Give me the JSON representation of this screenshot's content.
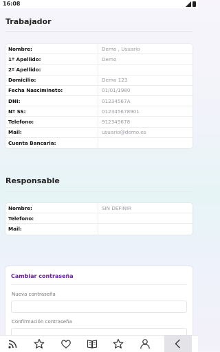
{
  "status_bar": {
    "time": "16:08"
  },
  "worker": {
    "title": "Trabajador",
    "rows": [
      {
        "label": "Nombre:",
        "value": "Demo , Usuario"
      },
      {
        "label": "1º Apellido:",
        "value": "Demo"
      },
      {
        "label": "2º Apellido:",
        "value": ""
      },
      {
        "label": "Domicilio:",
        "value": "Demo 123"
      },
      {
        "label": "Fecha Nascimineto:",
        "value": "01/01/1980"
      },
      {
        "label": "DNI:",
        "value": "01234567A"
      },
      {
        "label": "Nº SS:",
        "value": "012345678901"
      },
      {
        "label": "Telefono:",
        "value": "912345678"
      },
      {
        "label": "Mail:",
        "value": "usuario@demo.es"
      },
      {
        "label": "Cuenta Bancaria:",
        "value": ""
      }
    ]
  },
  "responsible": {
    "title": "Responsable",
    "rows": [
      {
        "label": "Nombre:",
        "value": "SIN DEFINIR"
      },
      {
        "label": "Telefono:",
        "value": ""
      },
      {
        "label": "Mail:",
        "value": ""
      }
    ]
  },
  "password": {
    "title": "Cambiar contraseña",
    "new_label": "Nueva contraseña",
    "new_value": "",
    "confirm_label": "Confirmación contraseña",
    "confirm_value": ""
  },
  "tab_bar": {
    "icons": [
      "rss-icon",
      "star-icon",
      "heart-icon",
      "book-icon",
      "star-icon",
      "user-icon",
      "back-chevron-icon"
    ]
  },
  "colors": {
    "accent": "#6a1fa8"
  }
}
